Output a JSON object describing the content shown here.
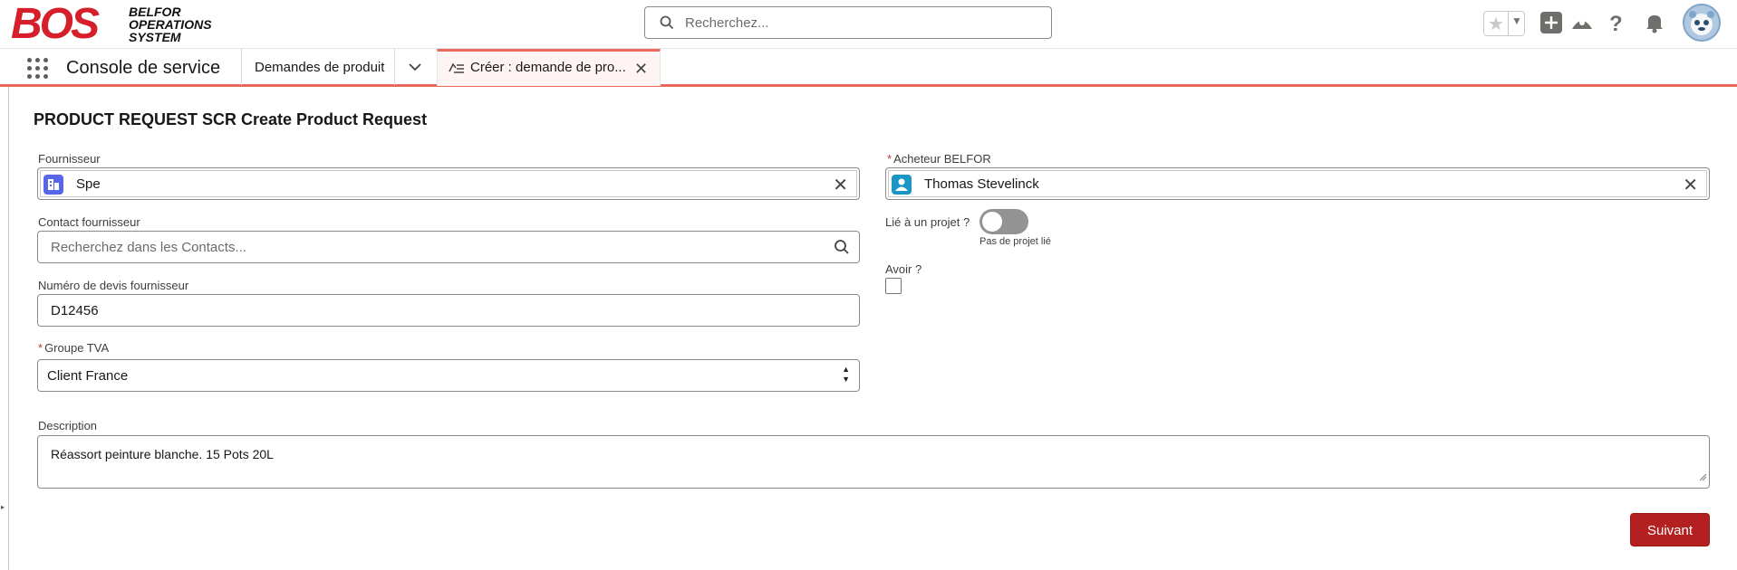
{
  "header": {
    "logo_main": "BOS",
    "logo_line1": "BELFOR",
    "logo_line2": "OPERATIONS",
    "logo_line3": "SYSTEM",
    "search_placeholder": "Recherchez...",
    "icons": [
      "star-icon",
      "plus-icon",
      "trailhead-icon",
      "help-icon",
      "bell-icon",
      "avatar"
    ]
  },
  "nav": {
    "app_name": "Console de service",
    "tabs": [
      {
        "label": "Demandes de produit"
      },
      {
        "label": "Créer : demande de pro..."
      }
    ]
  },
  "form": {
    "title": "PRODUCT REQUEST SCR Create Product Request",
    "supplier": {
      "label": "Fournisseur",
      "value": "Spe"
    },
    "buyer": {
      "label": "Acheteur BELFOR",
      "required": "*",
      "value": "Thomas Stevelinck"
    },
    "supplier_contact": {
      "label": "Contact fournisseur",
      "placeholder": "Recherchez dans les Contacts..."
    },
    "linked_project": {
      "label": "Lié à un projet ?",
      "hint": "Pas de projet lié"
    },
    "quote_number": {
      "label": "Numéro de devis fournisseur",
      "value": "D12456"
    },
    "credit_note": {
      "label": "Avoir ?"
    },
    "vat_group": {
      "label": "Groupe TVA",
      "required": "*",
      "value": "Client France"
    },
    "description": {
      "label": "Description",
      "value": "Réassort peinture blanche. 15 Pots 20L"
    },
    "next_button": "Suivant"
  },
  "colors": {
    "brand_red": "#d61f2a",
    "button_red": "#b41f1f",
    "tab_accent": "#e8685c",
    "account_icon": "#5867e8",
    "contact_icon": "#1b96c4"
  }
}
